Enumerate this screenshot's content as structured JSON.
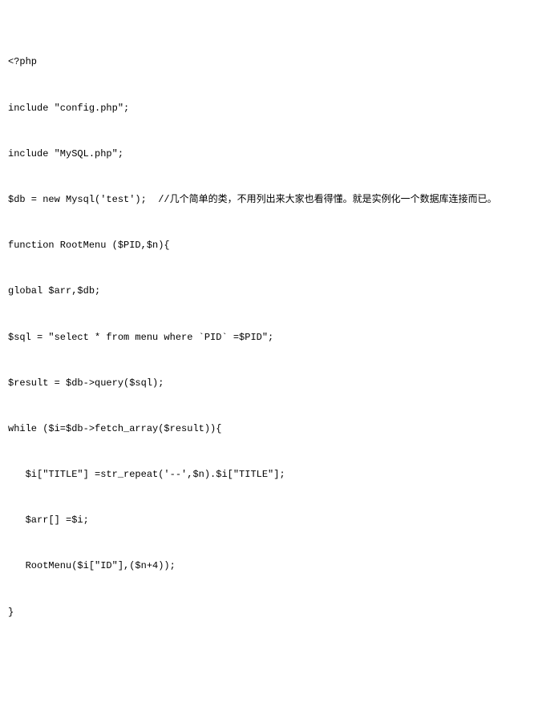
{
  "code": {
    "lines": [
      "<?php",
      "include \"config.php\";",
      "include \"MySQL.php\";",
      "$db = new Mysql('test');  //几个简单的类，不用列出来大家也看得懂。就是实例化一个数据库连接而已。",
      "function RootMenu ($PID,$n){",
      "global $arr,$db;",
      "$sql = \"select * from menu where `PID` =$PID\";",
      "$result = $db->query($sql);",
      "while ($i=$db->fetch_array($result)){",
      "   $i[\"TITLE\"] =str_repeat('--',$n).$i[\"TITLE\"];",
      "   $arr[] =$i;",
      "   RootMenu($i[\"ID\"],($n+4));",
      "}"
    ]
  }
}
